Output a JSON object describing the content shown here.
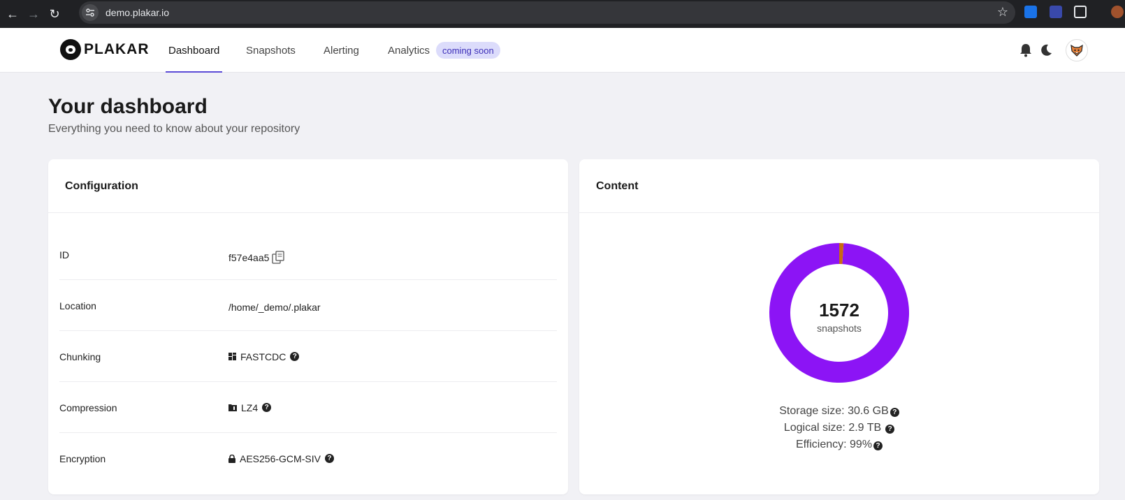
{
  "browser": {
    "url": "demo.plakar.io"
  },
  "header": {
    "logo_text": "PLAKAR",
    "tabs": [
      {
        "label": "Dashboard",
        "active": true
      },
      {
        "label": "Snapshots"
      },
      {
        "label": "Alerting"
      },
      {
        "label": "Analytics"
      }
    ],
    "analytics_badge": "coming soon"
  },
  "page": {
    "title": "Your dashboard",
    "subtitle": "Everything you need to know about your repository"
  },
  "configuration": {
    "title": "Configuration",
    "rows": [
      {
        "label": "ID",
        "value": "f57e4aa5"
      },
      {
        "label": "Location",
        "value": "/home/_demo/.plakar"
      },
      {
        "label": "Chunking",
        "value": "FASTCDC"
      },
      {
        "label": "Compression",
        "value": "LZ4"
      },
      {
        "label": "Encryption",
        "value": "AES256-GCM-SIV"
      }
    ]
  },
  "content": {
    "title": "Content",
    "snapshot_count": "1572",
    "snapshot_label": "snapshots",
    "storage_size": "Storage size: 30.6 GB",
    "logical_size": "Logical size: 2.9 TB",
    "efficiency": "Efficiency: 99%"
  },
  "chart_data": {
    "type": "pie",
    "categories": [
      "",
      ""
    ],
    "values": [
      99,
      1
    ],
    "colors": [
      "#8c14f5",
      "#c96a12"
    ]
  },
  "colors": {
    "accent": "#5b4bd6",
    "badge_bg": "#dcdcfb",
    "donut_main": "#8c14f5",
    "donut_small": "#c96a12"
  }
}
